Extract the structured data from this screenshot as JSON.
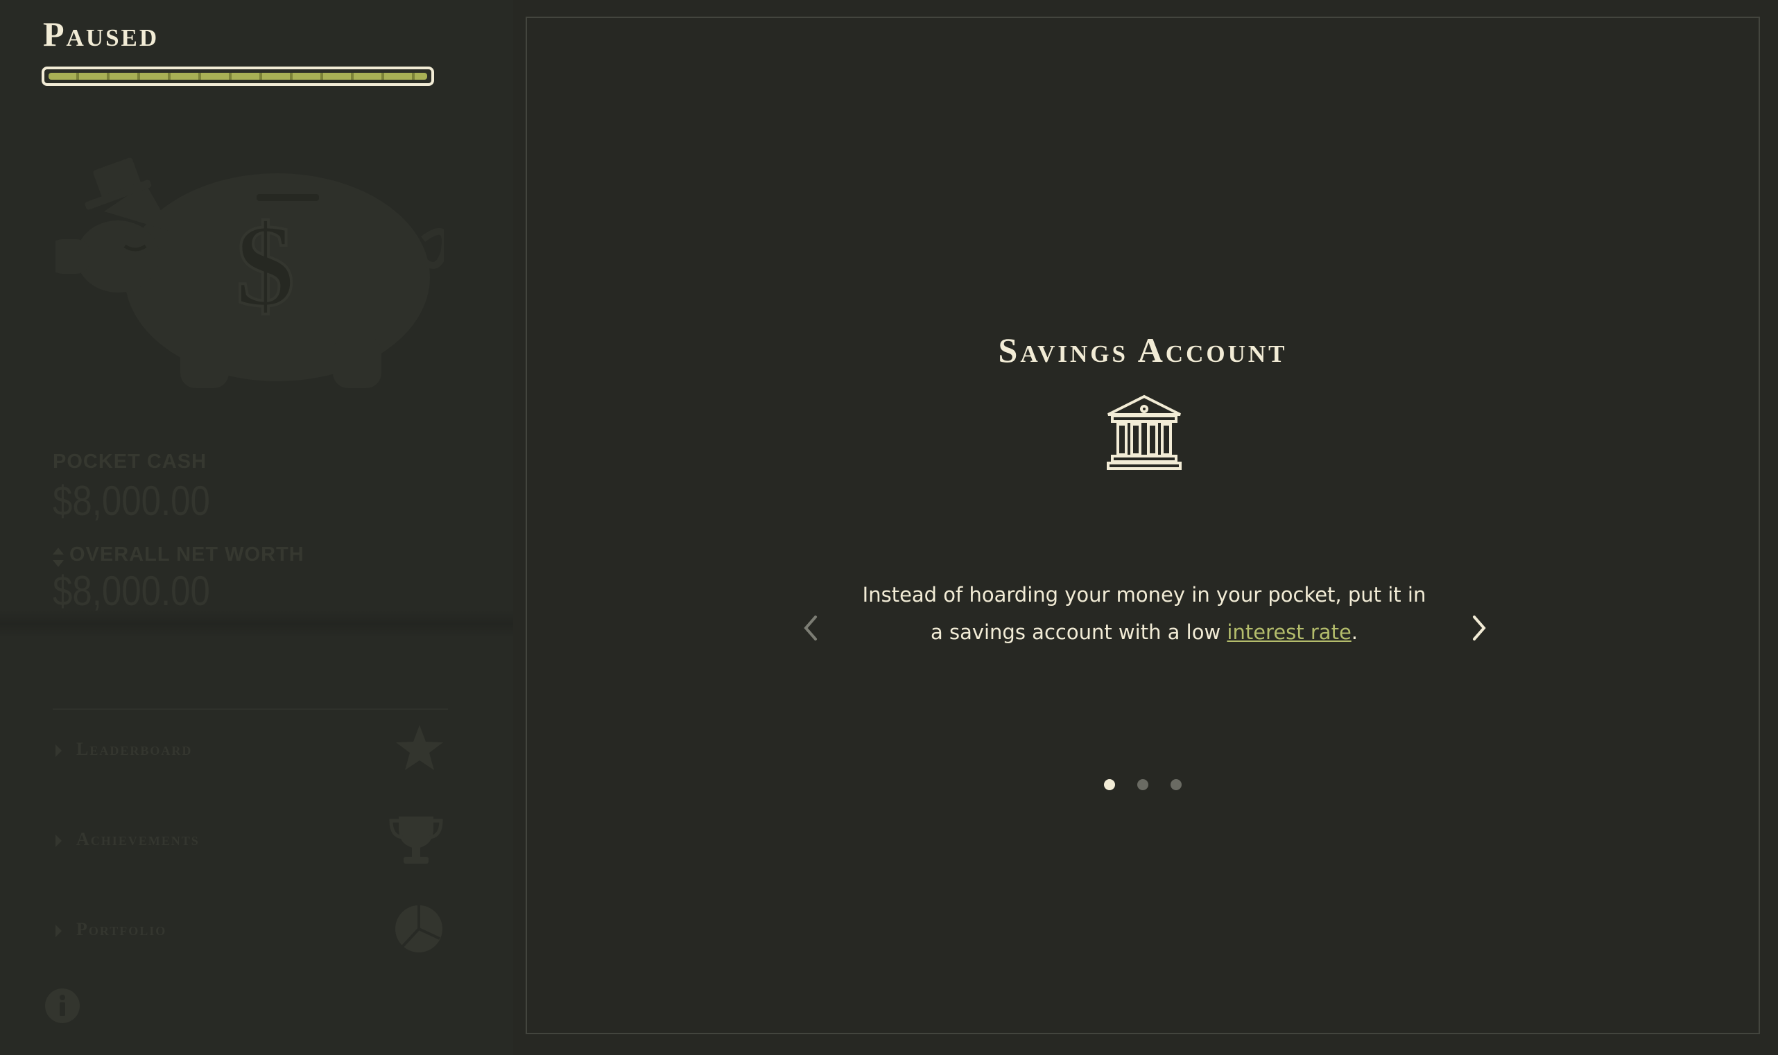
{
  "sidebar": {
    "title": "Paused",
    "progress": 1.0,
    "pocket_cash": {
      "label": "POCKET CASH",
      "value": "$8,000.00"
    },
    "net_worth": {
      "label": "OVERALL NET WORTH",
      "value": "$8,000.00"
    },
    "menu": [
      {
        "label": "Leaderboard",
        "icon": "star-icon"
      },
      {
        "label": "Achievements",
        "icon": "trophy-icon"
      },
      {
        "label": "Portfolio",
        "icon": "pie-chart-icon"
      }
    ],
    "info_icon": "info-icon"
  },
  "slide": {
    "title": "Savings Account",
    "icon": "bank-icon",
    "text_before": "Instead of hoarding your money in your pocket, put it in a savings account with a low ",
    "link": "interest rate",
    "text_after": ".",
    "dots": [
      {
        "active": true
      },
      {
        "active": false
      },
      {
        "active": false
      }
    ]
  },
  "colors": {
    "background": "#272823",
    "text": "#f2ecd6",
    "accent": "#b4bd6c",
    "progress": "#a8b055",
    "dim": "#34362f"
  }
}
